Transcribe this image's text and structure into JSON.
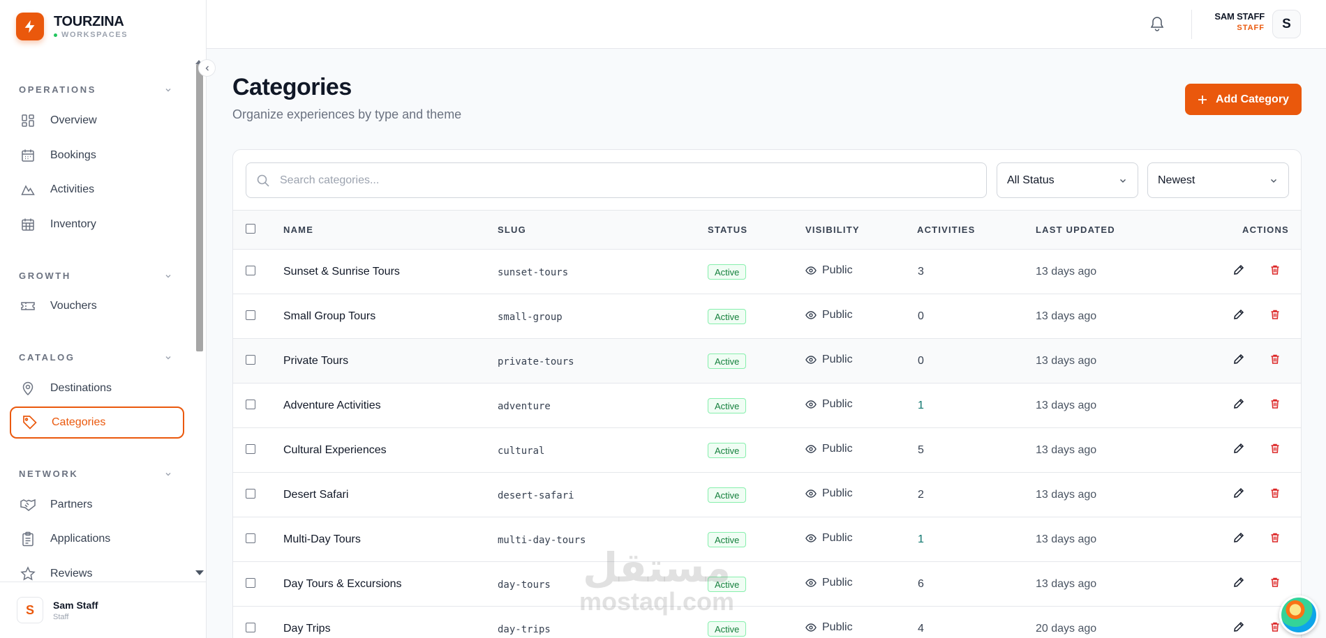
{
  "brand": {
    "name": "TOURZINA",
    "subtitle": "WORKSPACES"
  },
  "sidebar": {
    "sections": [
      {
        "title": "OPERATIONS",
        "items": [
          {
            "label": "Overview",
            "icon": "grid-icon"
          },
          {
            "label": "Bookings",
            "icon": "calendar-icon"
          },
          {
            "label": "Activities",
            "icon": "mountain-icon"
          },
          {
            "label": "Inventory",
            "icon": "calendar-grid-icon"
          }
        ]
      },
      {
        "title": "GROWTH",
        "items": [
          {
            "label": "Vouchers",
            "icon": "ticket-icon"
          }
        ]
      },
      {
        "title": "CATALOG",
        "items": [
          {
            "label": "Destinations",
            "icon": "map-pin-icon"
          },
          {
            "label": "Categories",
            "icon": "tag-icon",
            "active": true
          }
        ]
      },
      {
        "title": "NETWORK",
        "items": [
          {
            "label": "Partners",
            "icon": "handshake-icon"
          },
          {
            "label": "Applications",
            "icon": "clipboard-icon"
          },
          {
            "label": "Reviews",
            "icon": "star-icon"
          }
        ]
      }
    ],
    "user": {
      "initial": "S",
      "name": "Sam Staff",
      "role": "Staff"
    }
  },
  "header": {
    "user_name": "SAM STAFF",
    "user_role": "STAFF",
    "avatar_initial": "S"
  },
  "page": {
    "title": "Categories",
    "subtitle": "Organize experiences by type and theme",
    "add_button": "Add Category"
  },
  "filters": {
    "search_placeholder": "Search categories...",
    "status_select": "All Status",
    "sort_select": "Newest"
  },
  "table": {
    "columns": [
      "NAME",
      "SLUG",
      "STATUS",
      "VISIBILITY",
      "ACTIVITIES",
      "LAST UPDATED",
      "ACTIONS"
    ],
    "rows": [
      {
        "name": "Sunset & Sunrise Tours",
        "slug": "sunset-tours",
        "status": "Active",
        "visibility": "Public",
        "activities": "3",
        "updated": "13 days ago"
      },
      {
        "name": "Small Group Tours",
        "slug": "small-group",
        "status": "Active",
        "visibility": "Public",
        "activities": "0",
        "updated": "13 days ago"
      },
      {
        "name": "Private Tours",
        "slug": "private-tours",
        "status": "Active",
        "visibility": "Public",
        "activities": "0",
        "updated": "13 days ago"
      },
      {
        "name": "Adventure Activities",
        "slug": "adventure",
        "status": "Active",
        "visibility": "Public",
        "activities": "1",
        "updated": "13 days ago"
      },
      {
        "name": "Cultural Experiences",
        "slug": "cultural",
        "status": "Active",
        "visibility": "Public",
        "activities": "5",
        "updated": "13 days ago"
      },
      {
        "name": "Desert Safari",
        "slug": "desert-safari",
        "status": "Active",
        "visibility": "Public",
        "activities": "2",
        "updated": "13 days ago"
      },
      {
        "name": "Multi-Day Tours",
        "slug": "multi-day-tours",
        "status": "Active",
        "visibility": "Public",
        "activities": "1",
        "updated": "13 days ago"
      },
      {
        "name": "Day Tours & Excursions",
        "slug": "day-tours",
        "status": "Active",
        "visibility": "Public",
        "activities": "6",
        "updated": "13 days ago"
      },
      {
        "name": "Day Trips",
        "slug": "day-trips",
        "status": "Active",
        "visibility": "Public",
        "activities": "4",
        "updated": "20 days ago"
      }
    ]
  },
  "watermark": {
    "arabic": "مستقل",
    "latin": "mostaql.com"
  },
  "colors": {
    "accent": "#ea580c",
    "active_green": "#15803d",
    "delete_red": "#dc2626"
  }
}
